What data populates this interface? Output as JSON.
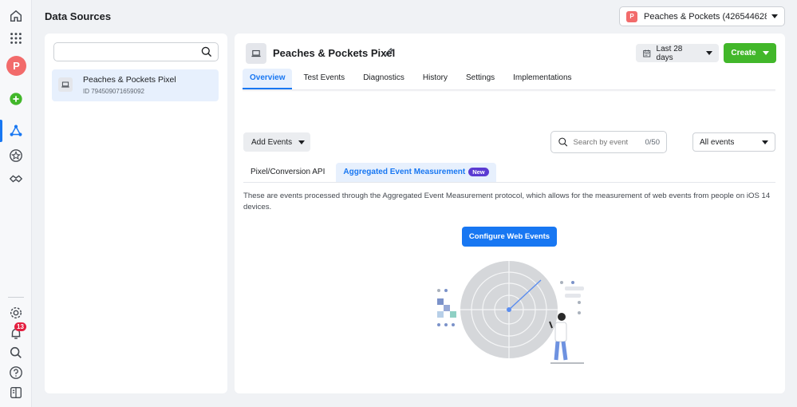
{
  "header": {
    "title": "Data Sources",
    "account": {
      "initial": "P",
      "name": "Peaches & Pockets (4265446288…"
    }
  },
  "rail": {
    "avatar_initial": "P",
    "notification_count": "13"
  },
  "left_panel": {
    "search_placeholder": "",
    "sources": [
      {
        "name": "Peaches & Pockets Pixel",
        "id": "ID 794509071659092"
      }
    ]
  },
  "main": {
    "pixel_title": "Peaches & Pockets Pixel",
    "date_range": "Last 28 days",
    "create_label": "Create",
    "tabs": [
      "Overview",
      "Test Events",
      "Diagnostics",
      "History",
      "Settings",
      "Implementations"
    ],
    "active_tab": "Overview",
    "add_events_label": "Add Events",
    "event_search_placeholder": "Search by event",
    "event_search_count": "0/50",
    "event_filter": "All events",
    "subtabs": [
      "Pixel/Conversion API",
      "Aggregated Event Measurement"
    ],
    "new_badge": "New",
    "description": "These are events processed through the Aggregated Event Measurement protocol, which allows for the measurement of web events from people on iOS 14 devices.",
    "configure_label": "Configure Web Events"
  },
  "colors": {
    "accent": "#1877f2",
    "create": "#42b72a",
    "avatar": "#f26b6b",
    "badge": "#5b3bd2"
  }
}
